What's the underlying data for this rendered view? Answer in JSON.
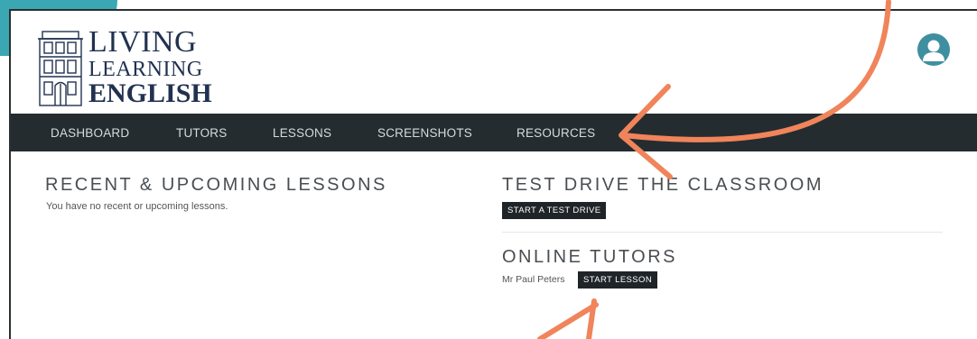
{
  "logo": {
    "line1": "LIVING",
    "line2": "LEARNING",
    "line3": "ENGLISH"
  },
  "nav": {
    "items": [
      {
        "label": "DASHBOARD"
      },
      {
        "label": "TUTORS"
      },
      {
        "label": "LESSONS"
      },
      {
        "label": "SCREENSHOTS"
      },
      {
        "label": "RESOURCES"
      }
    ]
  },
  "recent": {
    "title": "RECENT & UPCOMING LESSONS",
    "empty_text": "You have no recent or upcoming lessons."
  },
  "test_drive": {
    "title": "TEST DRIVE THE CLASSROOM",
    "button": "START A TEST DRIVE"
  },
  "online_tutors": {
    "title": "ONLINE TUTORS",
    "tutor_name": "Mr Paul Peters",
    "button": "START LESSON"
  },
  "colors": {
    "navbar": "#252c30",
    "accent_teal": "#3aa7b3",
    "arrow": "#f0845a",
    "logo_navy": "#213250"
  },
  "icons": [
    "user-avatar-icon",
    "building-logo-icon",
    "arrow-annotation"
  ]
}
